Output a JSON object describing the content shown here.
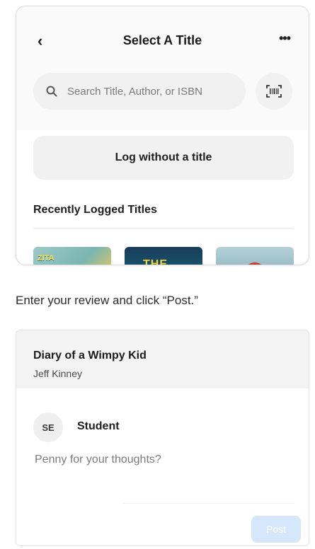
{
  "screen1": {
    "back_icon": "chevron-left-icon",
    "title": "Select A Title",
    "more_icon": "more-horizontal-icon",
    "search": {
      "placeholder": "Search Title, Author, or ISBN",
      "value": ""
    },
    "scan_icon": "barcode-scan-icon",
    "log_without_title_label": "Log without a title",
    "recent_heading": "Recently Logged Titles",
    "books": [
      {
        "cover_text": "ZITA"
      },
      {
        "cover_text": "THE LAST"
      },
      {
        "cover_text": ""
      }
    ]
  },
  "instruction": "Enter your review and click “Post.”",
  "screen2": {
    "book_title": "Diary of a Wimpy Kid",
    "author": "Jeff Kinney",
    "user_initials": "SE",
    "user_name": "Student",
    "review": {
      "placeholder": "Penny for your thoughts?",
      "value": ""
    },
    "post_label": "Post"
  },
  "colors": {
    "post_button_disabled": "#d6e6fb",
    "surface": "#f1f1f1"
  }
}
